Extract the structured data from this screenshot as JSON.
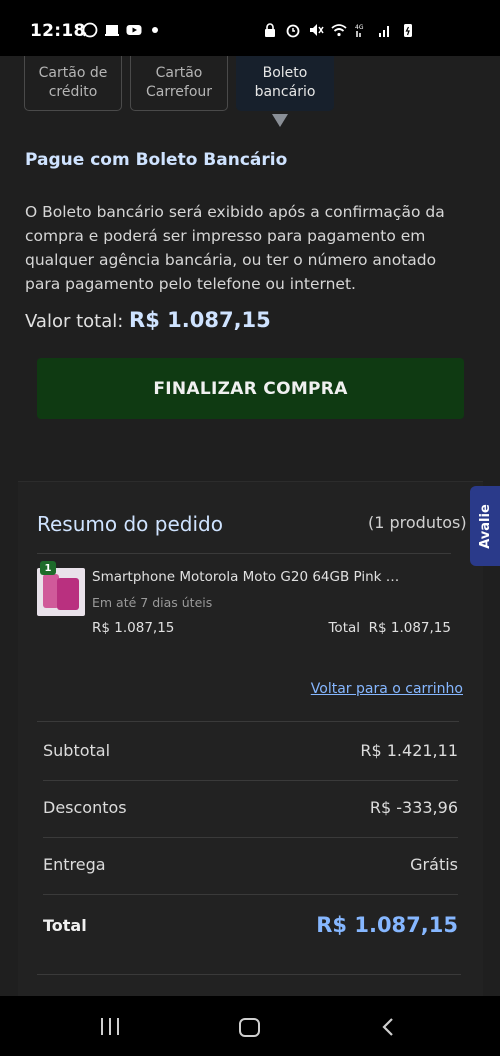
{
  "statusbar": {
    "time": "12:18",
    "signal_label": "4G"
  },
  "tabs": [
    {
      "line1": "Cartão de",
      "line2": "crédito"
    },
    {
      "line1": "Cartão",
      "line2": "Carrefour"
    },
    {
      "line1": "Boleto",
      "line2": "bancário"
    }
  ],
  "boleto": {
    "title": "Pague com Boleto Bancário",
    "description": "O Boleto bancário será exibido após a confirmação da compra e poderá ser impresso para pagamento em qualquer agência bancária, ou ter o número anotado para pagamento pelo telefone ou internet.",
    "total_label": "Valor total:",
    "total_value": "R$ 1.087,15"
  },
  "finalizar_label": "FINALIZAR COMPRA",
  "avalie_label": "Avalie",
  "summary": {
    "title": "Resumo do pedido",
    "count": "(1 produtos)",
    "product": {
      "qty": "1",
      "name": "Smartphone Motorola Moto G20 64GB Pink 4...",
      "shipping": "Em até 7 dias úteis",
      "price": "R$ 1.087,15",
      "total_label": "Total",
      "total_value": "R$ 1.087,15"
    },
    "voltar_label": "Voltar para o carrinho",
    "rows": [
      {
        "label": "Subtotal",
        "value": "R$ 1.421,11"
      },
      {
        "label": "Descontos",
        "value": "R$ -333,96"
      },
      {
        "label": "Entrega",
        "value": "Grátis"
      },
      {
        "label": "Total",
        "value": "R$ 1.087,15"
      }
    ]
  },
  "colors": {
    "accent_blue": "#86b7ff",
    "button_green": "#0f3a12",
    "background": "#1f1f1f"
  }
}
